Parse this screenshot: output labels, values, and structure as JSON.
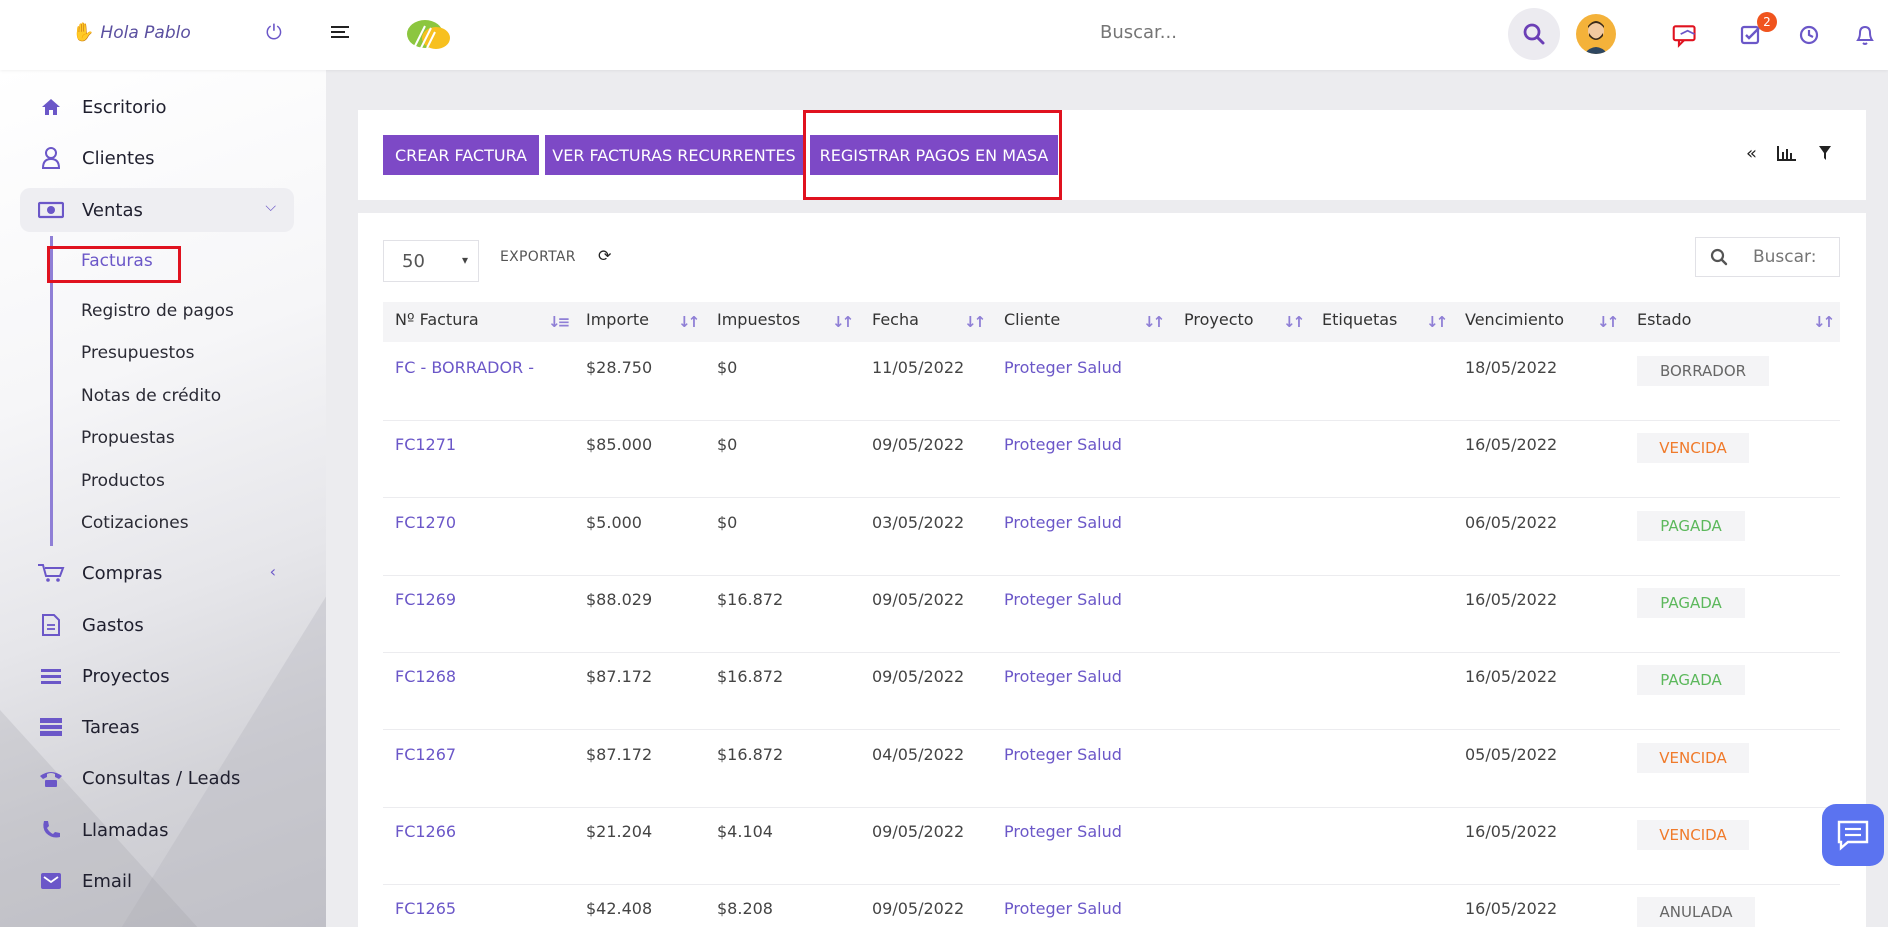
{
  "header": {
    "greeting": "Hola Pablo",
    "search_placeholder": "Buscar...",
    "task_badge": "2"
  },
  "sidebar": {
    "items": [
      {
        "label": "Escritorio",
        "icon": "home-icon"
      },
      {
        "label": "Clientes",
        "icon": "user-icon"
      },
      {
        "label": "Ventas",
        "icon": "money-icon"
      },
      {
        "label": "Compras",
        "icon": "cart-icon"
      },
      {
        "label": "Gastos",
        "icon": "file-icon"
      },
      {
        "label": "Proyectos",
        "icon": "bars-icon"
      },
      {
        "label": "Tareas",
        "icon": "tasks-icon"
      },
      {
        "label": "Consultas / Leads",
        "icon": "phone-icon"
      },
      {
        "label": "Llamadas",
        "icon": "call-icon"
      },
      {
        "label": "Email",
        "icon": "mail-icon"
      }
    ],
    "sub_items": [
      {
        "label": "Facturas"
      },
      {
        "label": "Registro de pagos"
      },
      {
        "label": "Presupuestos"
      },
      {
        "label": "Notas de crédito"
      },
      {
        "label": "Propuestas"
      },
      {
        "label": "Productos"
      },
      {
        "label": "Cotizaciones"
      }
    ]
  },
  "toolbar": {
    "crear_factura": "CREAR FACTURA",
    "ver_recurrentes": "VER FACTURAS RECURRENTES",
    "registrar_pagos": "REGISTRAR PAGOS EN MASA"
  },
  "table_controls": {
    "page_size": "50",
    "export_label": "EXPORTAR",
    "search_placeholder": "Buscar:"
  },
  "table": {
    "columns": [
      "Nº Factura",
      "Importe",
      "Impuestos",
      "Fecha",
      "Cliente",
      "Proyecto",
      "Etiquetas",
      "Vencimiento",
      "Estado"
    ],
    "rows": [
      {
        "numero": "FC - BORRADOR -",
        "importe": "$28.750",
        "impuestos": "$0",
        "fecha": "11/05/2022",
        "cliente": "Proteger Salud",
        "vencimiento": "18/05/2022",
        "estado": "BORRADOR"
      },
      {
        "numero": "FC1271",
        "importe": "$85.000",
        "impuestos": "$0",
        "fecha": "09/05/2022",
        "cliente": "Proteger Salud",
        "vencimiento": "16/05/2022",
        "estado": "VENCIDA"
      },
      {
        "numero": "FC1270",
        "importe": "$5.000",
        "impuestos": "$0",
        "fecha": "03/05/2022",
        "cliente": "Proteger Salud",
        "vencimiento": "06/05/2022",
        "estado": "PAGADA"
      },
      {
        "numero": "FC1269",
        "importe": "$88.029",
        "impuestos": "$16.872",
        "fecha": "09/05/2022",
        "cliente": "Proteger Salud",
        "vencimiento": "16/05/2022",
        "estado": "PAGADA"
      },
      {
        "numero": "FC1268",
        "importe": "$87.172",
        "impuestos": "$16.872",
        "fecha": "09/05/2022",
        "cliente": "Proteger Salud",
        "vencimiento": "16/05/2022",
        "estado": "PAGADA"
      },
      {
        "numero": "FC1267",
        "importe": "$87.172",
        "impuestos": "$16.872",
        "fecha": "04/05/2022",
        "cliente": "Proteger Salud",
        "vencimiento": "05/05/2022",
        "estado": "VENCIDA"
      },
      {
        "numero": "FC1266",
        "importe": "$21.204",
        "impuestos": "$4.104",
        "fecha": "09/05/2022",
        "cliente": "Proteger Salud",
        "vencimiento": "16/05/2022",
        "estado": "VENCIDA"
      },
      {
        "numero": "FC1265",
        "importe": "$42.408",
        "impuestos": "$8.208",
        "fecha": "09/05/2022",
        "cliente": "Proteger Salud",
        "vencimiento": "16/05/2022",
        "estado": "ANULADA"
      }
    ]
  },
  "colors": {
    "accent": "#7d49c6",
    "link": "#6b57c8",
    "highlight": "#e0121f",
    "vencida": "#f07a2a",
    "pagada": "#5cb85c"
  }
}
